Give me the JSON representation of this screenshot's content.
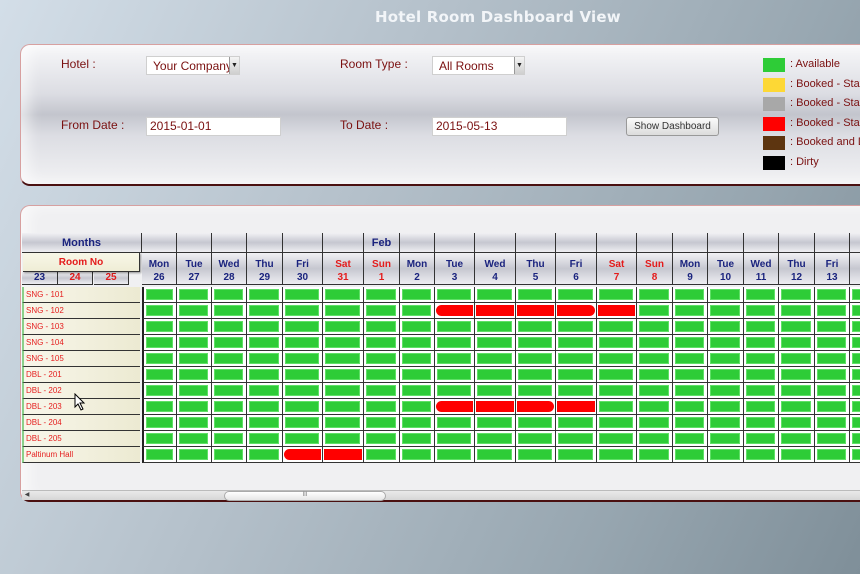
{
  "page_title": "Hotel Room Dashboard View",
  "filters": {
    "hotel_label": "Hotel :",
    "hotel_value": "Your Company",
    "room_type_label": "Room Type :",
    "room_type_value": "All Rooms",
    "from_date_label": "From Date :",
    "from_date_value": "2015-01-01",
    "to_date_label": "To Date :",
    "to_date_value": "2015-05-13",
    "show_button": "Show Dashboard"
  },
  "legend": [
    {
      "label": ": Available",
      "color": "#2ecc37"
    },
    {
      "label": ": Booked - Stat",
      "color": "#fdd835"
    },
    {
      "label": ": Booked - Stat",
      "color": "#a8a8a8"
    },
    {
      "label": ": Booked - Stat",
      "color": "#ff0000"
    },
    {
      "label": ": Booked and D",
      "color": "#5d3510"
    },
    {
      "label": ": Dirty",
      "color": "#000000"
    }
  ],
  "grid": {
    "months_label": "Months",
    "room_no_label": "Room No",
    "hidden_days": [
      {
        "num": "23",
        "weekend": false
      },
      {
        "num": "24",
        "weekend": true
      },
      {
        "num": "25",
        "weekend": true
      }
    ],
    "days": [
      {
        "dow": "Mon",
        "num": "26",
        "month": "",
        "weekend": false
      },
      {
        "dow": "Tue",
        "num": "27",
        "month": "",
        "weekend": false
      },
      {
        "dow": "Wed",
        "num": "28",
        "month": "",
        "weekend": false
      },
      {
        "dow": "Thu",
        "num": "29",
        "month": "",
        "weekend": false
      },
      {
        "dow": "Fri",
        "num": "30",
        "month": "",
        "weekend": false
      },
      {
        "dow": "Sat",
        "num": "31",
        "month": "",
        "weekend": true
      },
      {
        "dow": "Sun",
        "num": "1",
        "month": "Feb",
        "weekend": true
      },
      {
        "dow": "Mon",
        "num": "2",
        "month": "",
        "weekend": false
      },
      {
        "dow": "Tue",
        "num": "3",
        "month": "",
        "weekend": false
      },
      {
        "dow": "Wed",
        "num": "4",
        "month": "",
        "weekend": false
      },
      {
        "dow": "Thu",
        "num": "5",
        "month": "",
        "weekend": false
      },
      {
        "dow": "Fri",
        "num": "6",
        "month": "",
        "weekend": false
      },
      {
        "dow": "Sat",
        "num": "7",
        "month": "",
        "weekend": true
      },
      {
        "dow": "Sun",
        "num": "8",
        "month": "",
        "weekend": true
      },
      {
        "dow": "Mon",
        "num": "9",
        "month": "",
        "weekend": false
      },
      {
        "dow": "Tue",
        "num": "10",
        "month": "",
        "weekend": false
      },
      {
        "dow": "Wed",
        "num": "11",
        "month": "",
        "weekend": false
      },
      {
        "dow": "Thu",
        "num": "12",
        "month": "",
        "weekend": false
      },
      {
        "dow": "Fri",
        "num": "13",
        "month": "",
        "weekend": false
      },
      {
        "dow": "",
        "num": "",
        "month": "",
        "weekend": false
      }
    ],
    "rooms": [
      {
        "name": "SNG - 101",
        "status": "AAAAAAAAAAAAAAAAAAAA"
      },
      {
        "name": "SNG - 102",
        "status": "AAAAAAAARRRRRAAAAAAA"
      },
      {
        "name": "SNG - 103",
        "status": "AAAAAAAAAAAAAAAAAAAA"
      },
      {
        "name": "SNG - 104",
        "status": "AAAAAAAAAAAAAAAAAAAA"
      },
      {
        "name": "SNG - 105",
        "status": "AAAAAAAAAAAAAAAAAAAA"
      },
      {
        "name": "DBL - 201",
        "status": "AAAAAAAAAAAAAAAAAAAA"
      },
      {
        "name": "DBL - 202",
        "status": "AAAAAAAAAAAAAAAAAAAA"
      },
      {
        "name": "DBL - 203",
        "status": "AAAAAAAARRRRAAAAAAAA"
      },
      {
        "name": "DBL - 204",
        "status": "AAAAAAAAAAAAAAAAAAAA"
      },
      {
        "name": "DBL - 205",
        "status": "AAAAAAAAAAAAAAAAAAAA"
      },
      {
        "name": "Paltinum Hall",
        "status": "AAAARRAAAAAAAAAAAAAA"
      }
    ],
    "bookings": [
      {
        "room": "SNG - 102",
        "from": "Feb 3",
        "to": "Feb 7"
      },
      {
        "room": "DBL - 203",
        "from": "Feb 3",
        "to": "Feb 6"
      },
      {
        "room": "Paltinum Hall",
        "from": "Jan 30",
        "to": "Jan 31"
      }
    ]
  },
  "scrollbar": {
    "thumb_glyph": "III",
    "left_arrow": "◀"
  }
}
